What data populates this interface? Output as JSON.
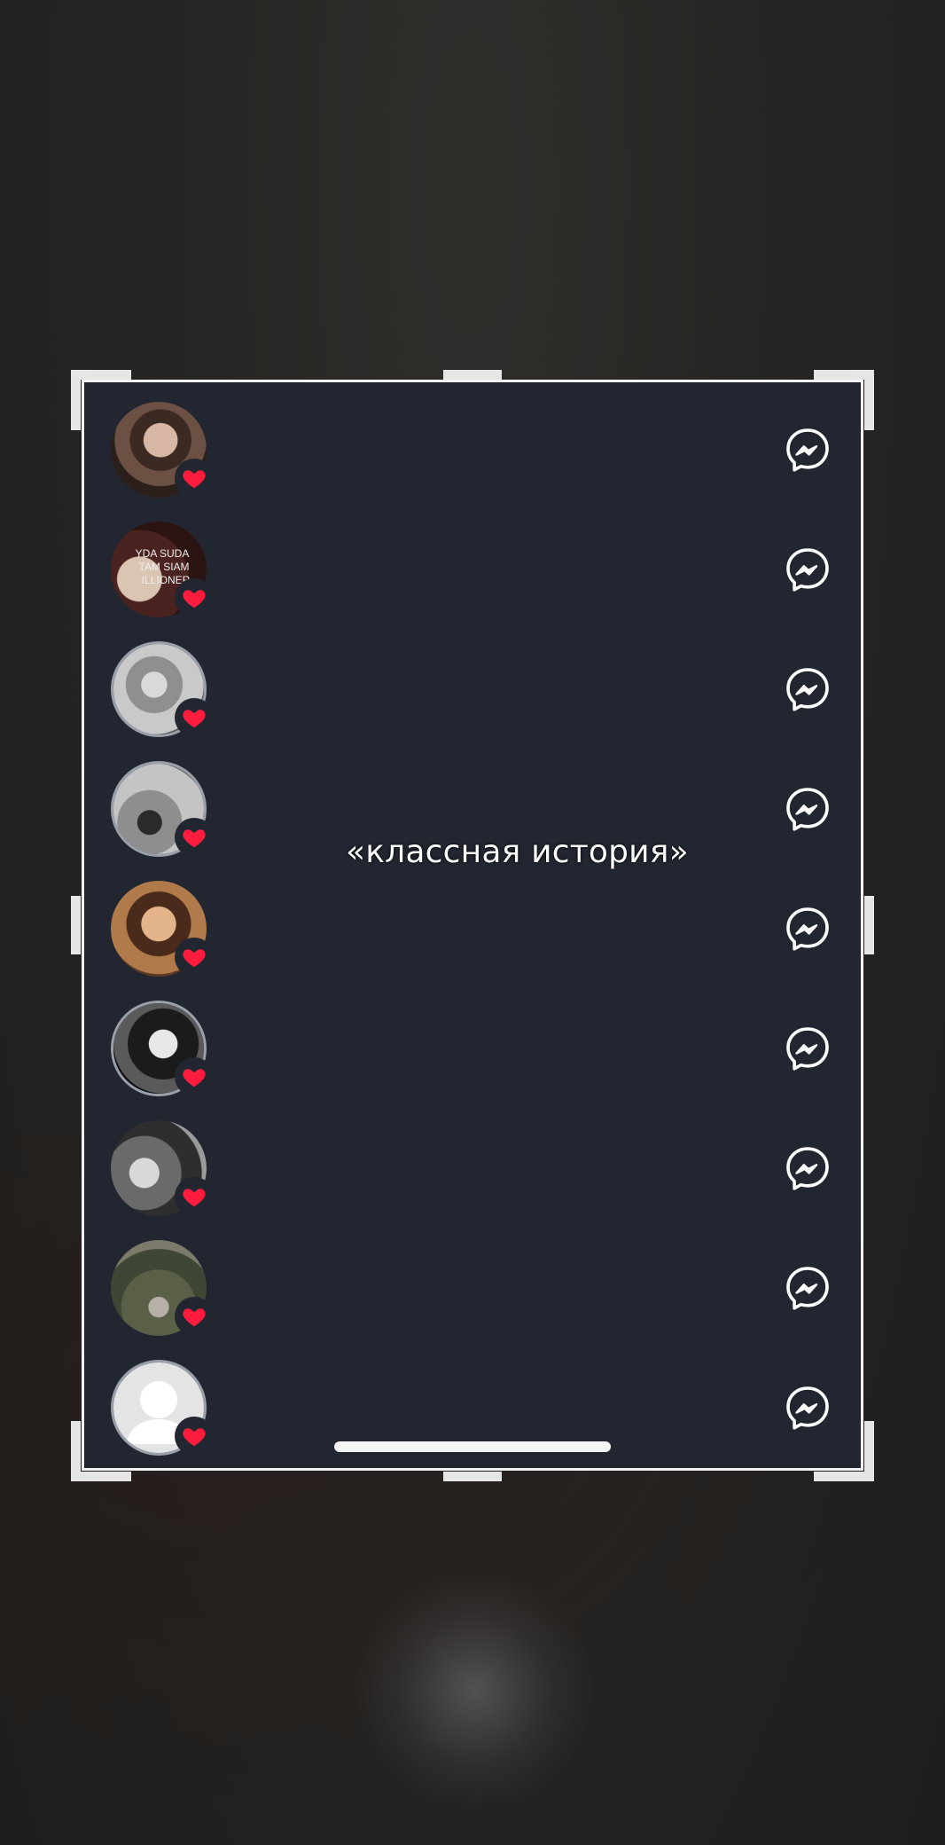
{
  "screen": {
    "caption": "«классная история»",
    "accent_color": "#ff1c3c",
    "panel_color": "#222630"
  },
  "likes_list": {
    "rows": [
      {
        "avatar": "user-photo",
        "badge_icon": "heart-icon",
        "action_icon": "messenger-icon"
      },
      {
        "avatar": "user-photo",
        "badge_icon": "heart-icon",
        "action_icon": "messenger-icon"
      },
      {
        "avatar": "user-photo",
        "badge_icon": "heart-icon",
        "action_icon": "messenger-icon"
      },
      {
        "avatar": "user-photo",
        "badge_icon": "heart-icon",
        "action_icon": "messenger-icon"
      },
      {
        "avatar": "user-photo",
        "badge_icon": "heart-icon",
        "action_icon": "messenger-icon"
      },
      {
        "avatar": "user-photo",
        "badge_icon": "heart-icon",
        "action_icon": "messenger-icon"
      },
      {
        "avatar": "user-photo",
        "badge_icon": "heart-icon",
        "action_icon": "messenger-icon"
      },
      {
        "avatar": "user-photo",
        "badge_icon": "heart-icon",
        "action_icon": "messenger-icon"
      },
      {
        "avatar": "default-avatar-placeholder",
        "badge_icon": "heart-icon",
        "action_icon": "messenger-icon"
      }
    ]
  },
  "avatar_photo_text": "YDA SUDA TAM SIAM ILLIONER"
}
